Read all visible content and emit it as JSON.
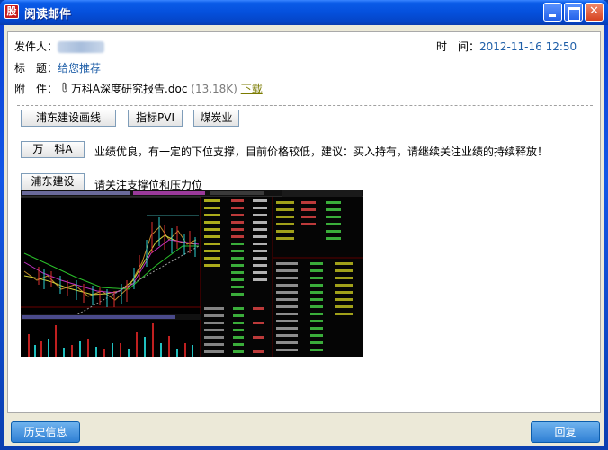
{
  "window": {
    "title": "阅读邮件",
    "app_icon_glyph": "股"
  },
  "header": {
    "sender_label": "发件人：",
    "time_label": "时　间：",
    "time_value": "2012-11-16 12:50",
    "subject_label": "标　题：",
    "subject_value": "给您推荐",
    "attachment_label": "附　件：",
    "attachment_name": "万科A深度研究报告.doc",
    "attachment_size": "(13.18K)",
    "download_label": "下载"
  },
  "tags": {
    "btn1": "浦东建设画线",
    "btn2": "指标PVI",
    "btn3": "煤炭业"
  },
  "recommendations": [
    {
      "button": "万　科A",
      "text": "业绩优良，有一定的下位支撑，目前价格较低，建议：买入持有，请继续关注业绩的持续释放！"
    },
    {
      "button": "浦东建设",
      "text": "请关注支撑位和压力位"
    }
  ],
  "footer": {
    "history_label": "历史信息",
    "reply_label": "回复"
  },
  "colors": {
    "titlebar": "#0550dc",
    "link": "#1f5fa8",
    "chart_bg": "#000000"
  },
  "icons": {
    "attachment": "paperclip-icon",
    "app": "stock-app-icon"
  }
}
